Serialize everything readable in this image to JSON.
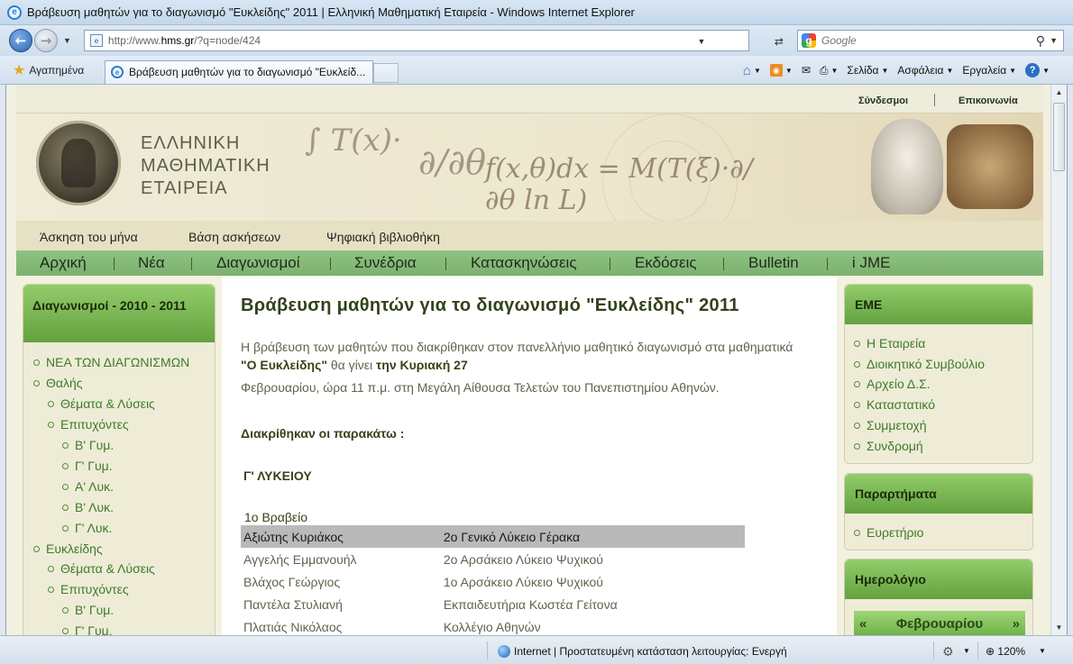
{
  "window": {
    "title": "Βράβευση μαθητών για το διαγωνισμό \"Ευκλείδης\" 2011 | Ελληνική Μαθηματική Εταιρεία - Windows Internet Explorer"
  },
  "address": {
    "url_prefix": "http://www.",
    "url_host": "hms.gr",
    "url_path": "/?q=node/424",
    "search_placeholder": "Google"
  },
  "tabs": {
    "favorites": "Αγαπημένα",
    "active_tab": "Βράβευση μαθητών για το διαγωνισμό \"Ευκλείδ..."
  },
  "commandbar": {
    "page": "Σελίδα",
    "safety": "Ασφάλεια",
    "tools": "Εργαλεία"
  },
  "status": {
    "zone": "Internet | Προστατευμένη κατάσταση λειτουργίας: Ενεργή",
    "zoom": "120%"
  },
  "site": {
    "toplinks": [
      "Σύνδεσμοι",
      "Επικοινωνία"
    ],
    "brand": [
      "ΕΛΛΗΝΙΚΗ",
      "ΜΑΘΗΜΑΤΙΚΗ",
      "ΕΤΑΙΡΕΙΑ"
    ],
    "subnav": [
      "Άσκηση του μήνα",
      "Βάση ασκήσεων",
      "Ψηφιακή βιβλιοθήκη"
    ],
    "mainnav": [
      "Αρχική",
      "Νέα",
      "Διαγωνισμοί",
      "Συνέδρια",
      "Κατασκηνώσεις",
      "Εκδόσεις",
      "Bulletin",
      "i JME"
    ]
  },
  "left": {
    "title": "Διαγωνισμοί - 2010 - 2011",
    "items": [
      {
        "label": "ΝΕΑ ΤΩΝ ΔΙΑΓΩΝΙΣΜΩΝ",
        "level": 0
      },
      {
        "label": "Θαλής",
        "level": 0
      },
      {
        "label": "Θέματα & Λύσεις",
        "level": 1
      },
      {
        "label": "Επιτυχόντες",
        "level": 1
      },
      {
        "label": "Β' Γυμ.",
        "level": 2
      },
      {
        "label": "Γ' Γυμ.",
        "level": 2
      },
      {
        "label": "Α' Λυκ.",
        "level": 2
      },
      {
        "label": "Β' Λυκ.",
        "level": 2
      },
      {
        "label": "Γ' Λυκ.",
        "level": 2
      },
      {
        "label": "Ευκλείδης",
        "level": 0
      },
      {
        "label": "Θέματα & Λύσεις",
        "level": 1
      },
      {
        "label": "Επιτυχόντες",
        "level": 1
      },
      {
        "label": "Β' Γυμ.",
        "level": 2
      },
      {
        "label": "Γ' Γυμ.",
        "level": 2
      }
    ]
  },
  "content": {
    "title": "Βράβευση μαθητών για το διαγωνισμό \"Ευκλείδης\" 2011",
    "intro_a": "Η βράβευση των μαθητών που διακρίθηκαν στον πανελλήνιο μαθητικό διαγωνισμό στα μαθηματικά",
    "intro_b1": "\"Ο Ευκλείδης\"",
    "intro_b2": " θα γίνει ",
    "intro_b3": "την Κυριακή 27",
    "intro_c": "Φεβρουαρίου, ώρα 11 π.μ. στη Μεγάλη Αίθουσα Τελετών του Πανεπιστημίου Αθηνών.",
    "distinguished": "Διακρίθηκαν οι παρακάτω :",
    "grade": "Γ' ΛΥΚΕΙΟΥ",
    "prize": "1ο Βραβείο",
    "winners": [
      {
        "name": "Αξιώτης Κυριάκος",
        "school": "2ο Γενικό Λύκειο Γέρακα"
      },
      {
        "name": "Αγγελής Εμμανουήλ",
        "school": "2ο Αρσάκειο Λύκειο Ψυχικού"
      },
      {
        "name": "Βλάχος Γεώργιος",
        "school": "1ο Αρσάκειο Λύκειο Ψυχικού"
      },
      {
        "name": "Παντέλα Στυλιανή",
        "school": "Εκπαιδευτήρια Κωστέα Γείτονα"
      },
      {
        "name": "Πλατιάς Νικόλαος",
        "school": "Κολλέγιο Αθηνών"
      }
    ]
  },
  "right": {
    "eme": {
      "title": "ΕΜΕ",
      "items": [
        "Η Εταιρεία",
        "Διοικητικό Συμβούλιο",
        "Αρχείο Δ.Σ.",
        "Καταστατικό",
        "Συμμετοχή",
        "Συνδρομή"
      ]
    },
    "branches": {
      "title": "Παραρτήματα",
      "items": [
        "Ευρετήριο"
      ]
    },
    "calendar": {
      "title": "Ημερολόγιο",
      "prev": "«",
      "month": "Φεβρουαρίου",
      "next": "»"
    }
  }
}
